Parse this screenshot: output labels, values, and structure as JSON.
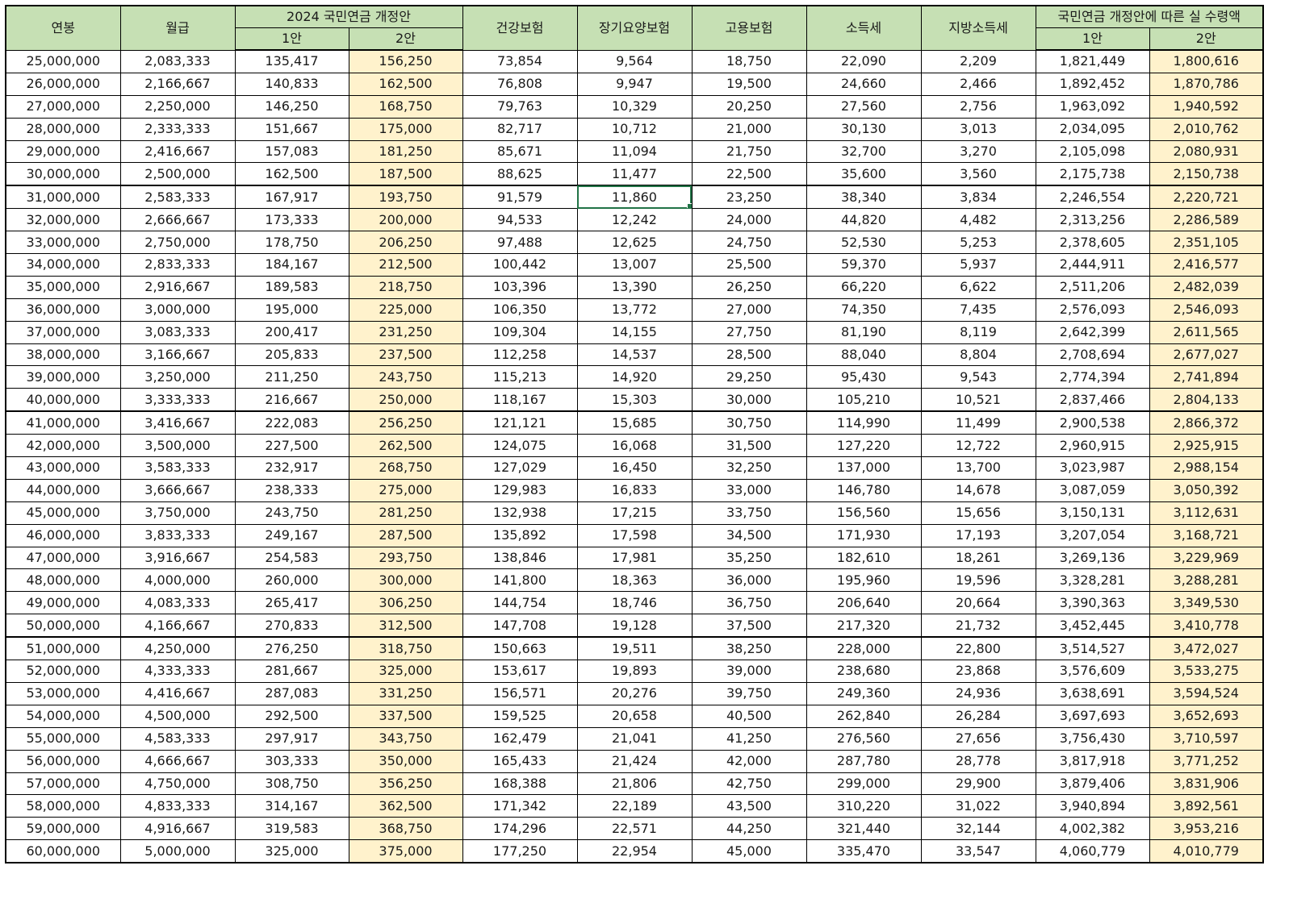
{
  "headers": {
    "salary": "연봉",
    "monthly": "월급",
    "pension_group": "2024 국민연금 개정안",
    "plan1": "1안",
    "plan2": "2안",
    "health": "건강보험",
    "longterm": "장기요양보험",
    "employment": "고용보험",
    "income_tax": "소득세",
    "local_tax": "지방소득세",
    "net_group": "국민연금 개정안에 따른 실 수령액",
    "net_plan1": "1안",
    "net_plan2": "2안"
  },
  "selected_cell": {
    "row": 6,
    "col": 5
  },
  "colors": {
    "header_bg": "#c6e0b4",
    "plan2_bg": "#fff2cc",
    "selection": "#217346"
  },
  "rows": [
    [
      "25,000,000",
      "2,083,333",
      "135,417",
      "156,250",
      "73,854",
      "9,564",
      "18,750",
      "22,090",
      "2,209",
      "1,821,449",
      "1,800,616"
    ],
    [
      "26,000,000",
      "2,166,667",
      "140,833",
      "162,500",
      "76,808",
      "9,947",
      "19,500",
      "24,660",
      "2,466",
      "1,892,452",
      "1,870,786"
    ],
    [
      "27,000,000",
      "2,250,000",
      "146,250",
      "168,750",
      "79,763",
      "10,329",
      "20,250",
      "27,560",
      "2,756",
      "1,963,092",
      "1,940,592"
    ],
    [
      "28,000,000",
      "2,333,333",
      "151,667",
      "175,000",
      "82,717",
      "10,712",
      "21,000",
      "30,130",
      "3,013",
      "2,034,095",
      "2,010,762"
    ],
    [
      "29,000,000",
      "2,416,667",
      "157,083",
      "181,250",
      "85,671",
      "11,094",
      "21,750",
      "32,700",
      "3,270",
      "2,105,098",
      "2,080,931"
    ],
    [
      "30,000,000",
      "2,500,000",
      "162,500",
      "187,500",
      "88,625",
      "11,477",
      "22,500",
      "35,600",
      "3,560",
      "2,175,738",
      "2,150,738"
    ],
    [
      "31,000,000",
      "2,583,333",
      "167,917",
      "193,750",
      "91,579",
      "11,860",
      "23,250",
      "38,340",
      "3,834",
      "2,246,554",
      "2,220,721"
    ],
    [
      "32,000,000",
      "2,666,667",
      "173,333",
      "200,000",
      "94,533",
      "12,242",
      "24,000",
      "44,820",
      "4,482",
      "2,313,256",
      "2,286,589"
    ],
    [
      "33,000,000",
      "2,750,000",
      "178,750",
      "206,250",
      "97,488",
      "12,625",
      "24,750",
      "52,530",
      "5,253",
      "2,378,605",
      "2,351,105"
    ],
    [
      "34,000,000",
      "2,833,333",
      "184,167",
      "212,500",
      "100,442",
      "13,007",
      "25,500",
      "59,370",
      "5,937",
      "2,444,911",
      "2,416,577"
    ],
    [
      "35,000,000",
      "2,916,667",
      "189,583",
      "218,750",
      "103,396",
      "13,390",
      "26,250",
      "66,220",
      "6,622",
      "2,511,206",
      "2,482,039"
    ],
    [
      "36,000,000",
      "3,000,000",
      "195,000",
      "225,000",
      "106,350",
      "13,772",
      "27,000",
      "74,350",
      "7,435",
      "2,576,093",
      "2,546,093"
    ],
    [
      "37,000,000",
      "3,083,333",
      "200,417",
      "231,250",
      "109,304",
      "14,155",
      "27,750",
      "81,190",
      "8,119",
      "2,642,399",
      "2,611,565"
    ],
    [
      "38,000,000",
      "3,166,667",
      "205,833",
      "237,500",
      "112,258",
      "14,537",
      "28,500",
      "88,040",
      "8,804",
      "2,708,694",
      "2,677,027"
    ],
    [
      "39,000,000",
      "3,250,000",
      "211,250",
      "243,750",
      "115,213",
      "14,920",
      "29,250",
      "95,430",
      "9,543",
      "2,774,394",
      "2,741,894"
    ],
    [
      "40,000,000",
      "3,333,333",
      "216,667",
      "250,000",
      "118,167",
      "15,303",
      "30,000",
      "105,210",
      "10,521",
      "2,837,466",
      "2,804,133"
    ],
    [
      "41,000,000",
      "3,416,667",
      "222,083",
      "256,250",
      "121,121",
      "15,685",
      "30,750",
      "114,990",
      "11,499",
      "2,900,538",
      "2,866,372"
    ],
    [
      "42,000,000",
      "3,500,000",
      "227,500",
      "262,500",
      "124,075",
      "16,068",
      "31,500",
      "127,220",
      "12,722",
      "2,960,915",
      "2,925,915"
    ],
    [
      "43,000,000",
      "3,583,333",
      "232,917",
      "268,750",
      "127,029",
      "16,450",
      "32,250",
      "137,000",
      "13,700",
      "3,023,987",
      "2,988,154"
    ],
    [
      "44,000,000",
      "3,666,667",
      "238,333",
      "275,000",
      "129,983",
      "16,833",
      "33,000",
      "146,780",
      "14,678",
      "3,087,059",
      "3,050,392"
    ],
    [
      "45,000,000",
      "3,750,000",
      "243,750",
      "281,250",
      "132,938",
      "17,215",
      "33,750",
      "156,560",
      "15,656",
      "3,150,131",
      "3,112,631"
    ],
    [
      "46,000,000",
      "3,833,333",
      "249,167",
      "287,500",
      "135,892",
      "17,598",
      "34,500",
      "171,930",
      "17,193",
      "3,207,054",
      "3,168,721"
    ],
    [
      "47,000,000",
      "3,916,667",
      "254,583",
      "293,750",
      "138,846",
      "17,981",
      "35,250",
      "182,610",
      "18,261",
      "3,269,136",
      "3,229,969"
    ],
    [
      "48,000,000",
      "4,000,000",
      "260,000",
      "300,000",
      "141,800",
      "18,363",
      "36,000",
      "195,960",
      "19,596",
      "3,328,281",
      "3,288,281"
    ],
    [
      "49,000,000",
      "4,083,333",
      "265,417",
      "306,250",
      "144,754",
      "18,746",
      "36,750",
      "206,640",
      "20,664",
      "3,390,363",
      "3,349,530"
    ],
    [
      "50,000,000",
      "4,166,667",
      "270,833",
      "312,500",
      "147,708",
      "19,128",
      "37,500",
      "217,320",
      "21,732",
      "3,452,445",
      "3,410,778"
    ],
    [
      "51,000,000",
      "4,250,000",
      "276,250",
      "318,750",
      "150,663",
      "19,511",
      "38,250",
      "228,000",
      "22,800",
      "3,514,527",
      "3,472,027"
    ],
    [
      "52,000,000",
      "4,333,333",
      "281,667",
      "325,000",
      "153,617",
      "19,893",
      "39,000",
      "238,680",
      "23,868",
      "3,576,609",
      "3,533,275"
    ],
    [
      "53,000,000",
      "4,416,667",
      "287,083",
      "331,250",
      "156,571",
      "20,276",
      "39,750",
      "249,360",
      "24,936",
      "3,638,691",
      "3,594,524"
    ],
    [
      "54,000,000",
      "4,500,000",
      "292,500",
      "337,500",
      "159,525",
      "20,658",
      "40,500",
      "262,840",
      "26,284",
      "3,697,693",
      "3,652,693"
    ],
    [
      "55,000,000",
      "4,583,333",
      "297,917",
      "343,750",
      "162,479",
      "21,041",
      "41,250",
      "276,560",
      "27,656",
      "3,756,430",
      "3,710,597"
    ],
    [
      "56,000,000",
      "4,666,667",
      "303,333",
      "350,000",
      "165,433",
      "21,424",
      "42,000",
      "287,780",
      "28,778",
      "3,817,918",
      "3,771,252"
    ],
    [
      "57,000,000",
      "4,750,000",
      "308,750",
      "356,250",
      "168,388",
      "21,806",
      "42,750",
      "299,000",
      "29,900",
      "3,879,406",
      "3,831,906"
    ],
    [
      "58,000,000",
      "4,833,333",
      "314,167",
      "362,500",
      "171,342",
      "22,189",
      "43,500",
      "310,220",
      "31,022",
      "3,940,894",
      "3,892,561"
    ],
    [
      "59,000,000",
      "4,916,667",
      "319,583",
      "368,750",
      "174,296",
      "22,571",
      "44,250",
      "321,440",
      "32,144",
      "4,002,382",
      "3,953,216"
    ],
    [
      "60,000,000",
      "5,000,000",
      "325,000",
      "375,000",
      "177,250",
      "22,954",
      "45,000",
      "335,470",
      "33,547",
      "4,060,779",
      "4,010,779"
    ]
  ]
}
